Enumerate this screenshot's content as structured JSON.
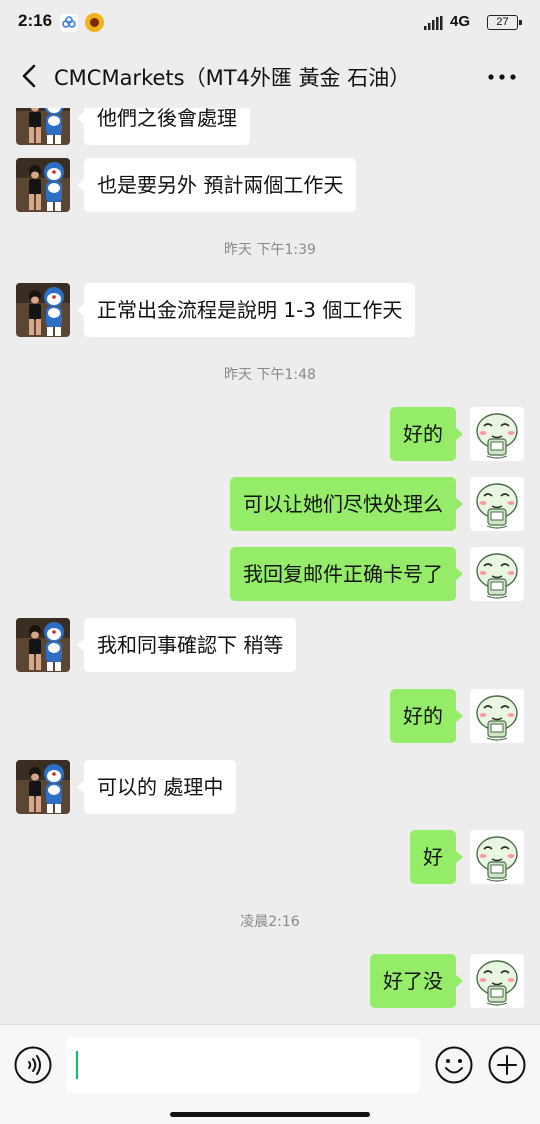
{
  "status_bar": {
    "time": "2:16",
    "network": "4G",
    "battery": "27"
  },
  "header": {
    "title": "CMCMarkets（MT4外匯 黃金 石油）",
    "back_icon": "chevron-left-icon",
    "more_icon": "more-dots-icon"
  },
  "messages": [
    {
      "side": "left",
      "text": "他們之後會處理"
    },
    {
      "side": "left",
      "text": "也是要另外 預計兩個工作天"
    },
    {
      "type": "time",
      "text": "昨天 下午1:39"
    },
    {
      "side": "left",
      "text": "正常出金流程是說明 1-3 個工作天"
    },
    {
      "type": "time",
      "text": "昨天 下午1:48"
    },
    {
      "side": "right",
      "text": "好的"
    },
    {
      "side": "right",
      "text": "可以让她们尽快处理么"
    },
    {
      "side": "right",
      "text": "我回复邮件正确卡号了"
    },
    {
      "side": "left",
      "text": "我和同事確認下 稍等"
    },
    {
      "side": "right",
      "text": "好的"
    },
    {
      "side": "left",
      "text": "可以的 處理中"
    },
    {
      "side": "right",
      "text": "好"
    },
    {
      "type": "time",
      "text": "凌晨2:16"
    },
    {
      "side": "right",
      "text": "好了没"
    }
  ],
  "input_bar": {
    "voice_icon": "voice-icon",
    "emoji_icon": "emoji-icon",
    "plus_icon": "plus-icon"
  },
  "colors": {
    "background": "#ededed",
    "bubble_self": "#95ec69",
    "bubble_other": "#ffffff",
    "cursor": "#07c160"
  }
}
